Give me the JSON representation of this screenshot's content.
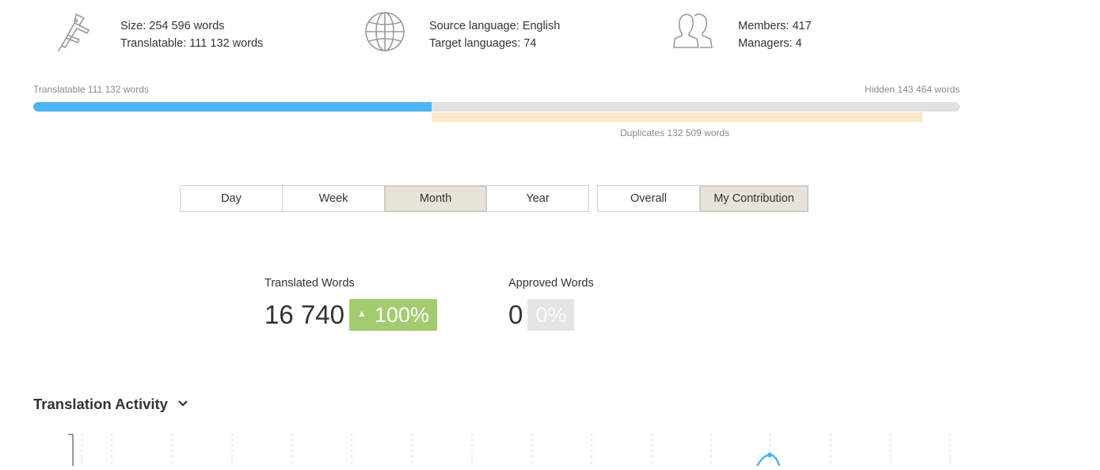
{
  "stats": {
    "size_label": "Size: 254 596 words",
    "translatable_label": "Translatable: 111 132 words",
    "source_language": "Source language: English",
    "target_languages": "Target languages: 74",
    "members": "Members: 417",
    "managers": "Managers: 4"
  },
  "progress": {
    "translatable_text": "Translatable 111 132 words",
    "hidden_text": "Hidden 143 464 words",
    "duplicates_text": "Duplicates 132 509 words",
    "translatable_fraction": 0.43,
    "duplicates_start_fraction": 0.43,
    "duplicates_end_fraction": 0.96,
    "fill_color": "#4db3f4",
    "track_color": "#e1e1e1",
    "duplicates_color": "#f8e8cc"
  },
  "period_tabs": [
    {
      "label": "Day",
      "active": false
    },
    {
      "label": "Week",
      "active": false
    },
    {
      "label": "Month",
      "active": true
    },
    {
      "label": "Year",
      "active": false
    }
  ],
  "scope_tabs": [
    {
      "label": "Overall",
      "active": false
    },
    {
      "label": "My Contribution",
      "active": true
    }
  ],
  "metrics": {
    "translated": {
      "label": "Translated Words",
      "value": "16 740",
      "change": "100%",
      "arrow": "▲"
    },
    "approved": {
      "label": "Approved Words",
      "value": "0",
      "change": "0%"
    }
  },
  "activity": {
    "title": "Translation Activity",
    "icon": "chevron-down-icon"
  },
  "colors": {
    "accent_blue": "#4db3f4",
    "badge_green": "#a3cc6e",
    "badge_gray": "#e4e4e4",
    "active_tab": "#e8e3d8"
  }
}
